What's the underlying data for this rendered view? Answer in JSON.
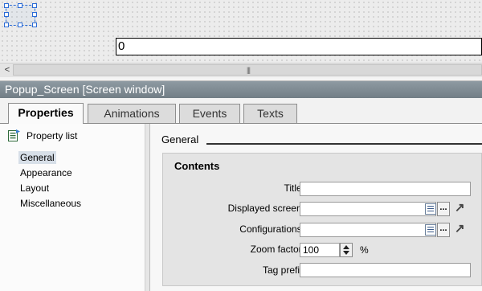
{
  "canvas": {
    "io_field_value": "0"
  },
  "scrollbar": {
    "left_arrow": "<",
    "grip": "|||"
  },
  "inspector": {
    "title": "Popup_Screen [Screen window]",
    "tabs": [
      {
        "label": "Properties",
        "active": true
      },
      {
        "label": "Animations",
        "active": false
      },
      {
        "label": "Events",
        "active": false
      },
      {
        "label": "Texts",
        "active": false
      }
    ]
  },
  "left_panel": {
    "property_list_label": "Property list",
    "items": [
      {
        "label": "General",
        "selected": true
      },
      {
        "label": "Appearance",
        "selected": false
      },
      {
        "label": "Layout",
        "selected": false
      },
      {
        "label": "Miscellaneous",
        "selected": false
      }
    ]
  },
  "right_panel": {
    "section_title": "General",
    "group_title": "Contents",
    "fields": {
      "title": {
        "label": "Title:",
        "value": ""
      },
      "displayed_screen": {
        "label": "Displayed screen:",
        "value": "",
        "browse": "..."
      },
      "configurations": {
        "label": "Configurations:",
        "value": "",
        "browse": "..."
      },
      "zoom_factor": {
        "label": "Zoom factor:",
        "value": "100",
        "unit": "%"
      },
      "tag_prefix": {
        "label": "Tag prefix",
        "value": ""
      }
    }
  },
  "colors": {
    "title_bar": "#7f8b93",
    "selection": "#2a6bd6"
  }
}
